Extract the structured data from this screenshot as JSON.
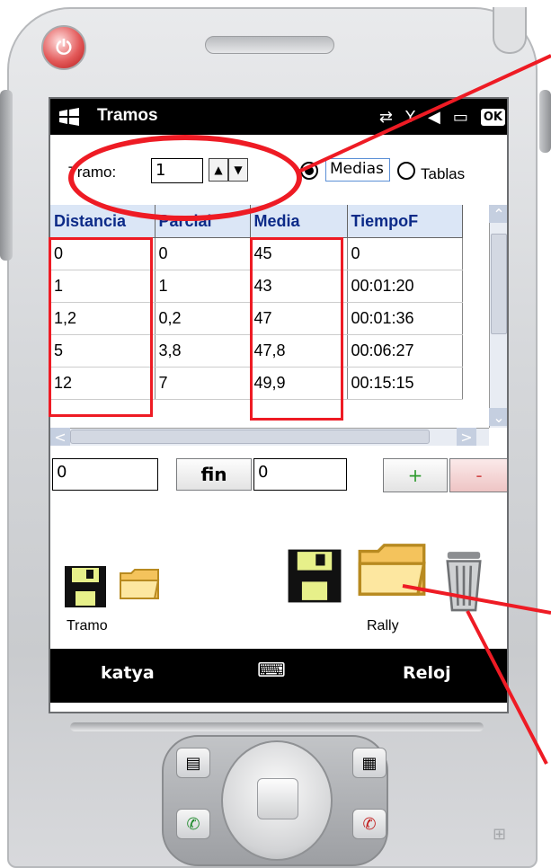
{
  "screen": {
    "title": "Tramos",
    "ok_label": "OK"
  },
  "controls": {
    "tramo_label": "Tramo:",
    "tramo_value": "1",
    "medias_label": "Medias",
    "tablas_label": "Tablas",
    "selected_view": "Medias"
  },
  "table": {
    "columns": [
      "Distancia",
      "Parcial",
      "Media",
      "TiempoF"
    ],
    "rows": [
      [
        "0",
        "0",
        "45",
        "0"
      ],
      [
        "1",
        "1",
        "43",
        "00:01:20"
      ],
      [
        "1,2",
        "0,2",
        "47",
        "00:01:36"
      ],
      [
        "5",
        "3,8",
        "47,8",
        "00:06:27"
      ],
      [
        "12",
        "7",
        "49,9",
        "00:15:15"
      ]
    ]
  },
  "inputs": {
    "left_value": "0",
    "fin_label": "fin",
    "right_value": "0",
    "plus_label": "+",
    "minus_label": "-"
  },
  "files": {
    "tramo_label": "Tramo",
    "rally_label": "Rally"
  },
  "softkeys": {
    "left": "katya",
    "right": "Reloj"
  },
  "colors": {
    "annotation": "#ee1b24",
    "header_bg": "#dbe6f6",
    "header_text": "#0c2a88"
  }
}
